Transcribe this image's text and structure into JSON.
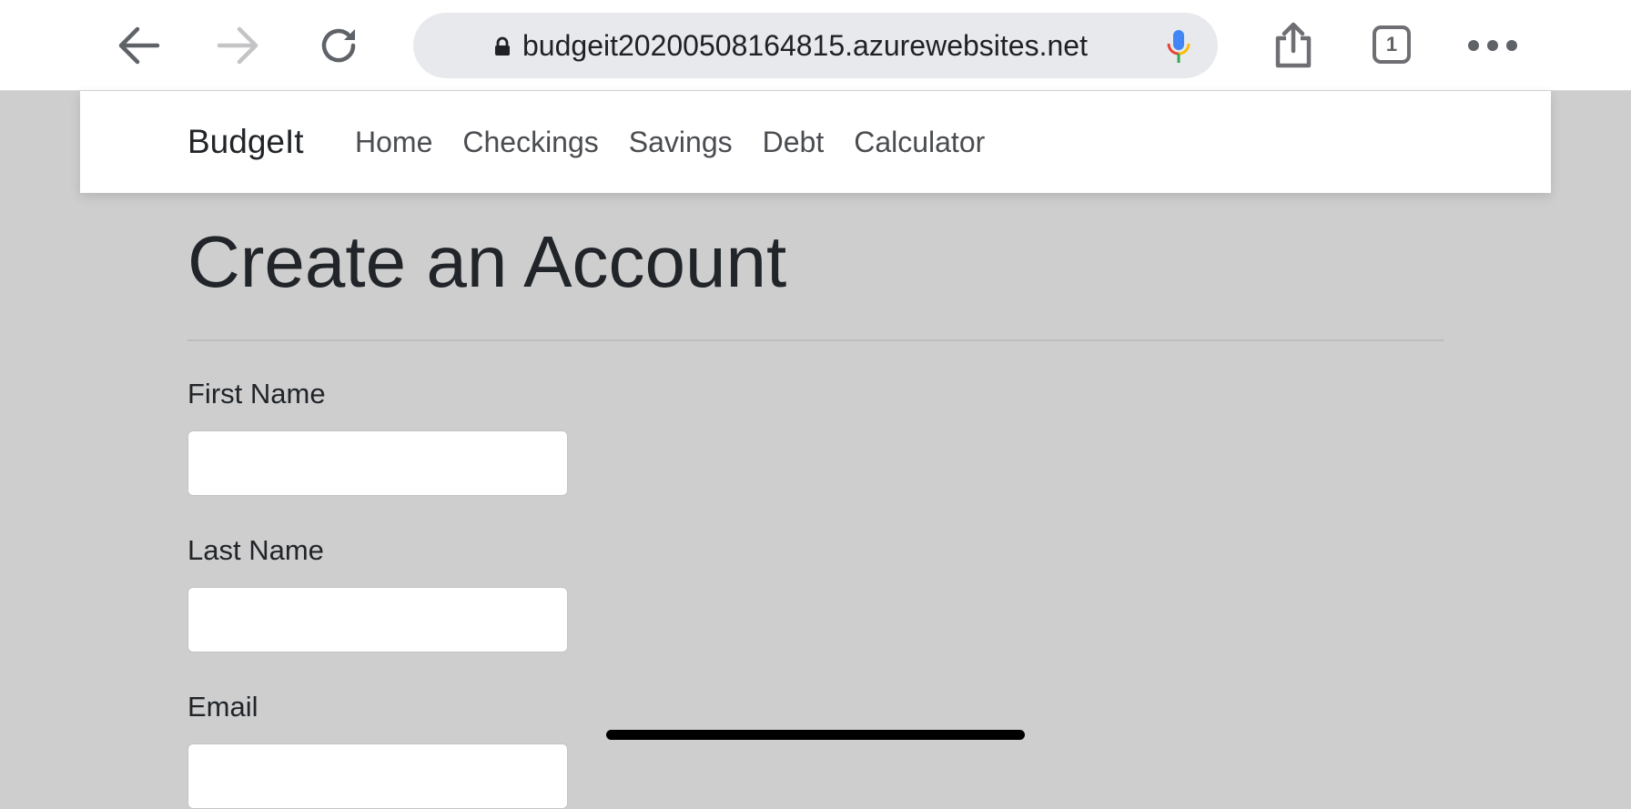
{
  "browser": {
    "url": "budgeit20200508164815.azurewebsites.net",
    "tab_count": "1"
  },
  "nav": {
    "brand": "BudgeIt",
    "links": [
      "Home",
      "Checkings",
      "Savings",
      "Debt",
      "Calculator"
    ]
  },
  "form": {
    "title": "Create an Account",
    "fields": [
      {
        "label": "First Name",
        "value": ""
      },
      {
        "label": "Last Name",
        "value": ""
      },
      {
        "label": "Email",
        "value": ""
      }
    ]
  },
  "colors": {
    "page_background": "#cecece",
    "navbar_background": "#ffffff",
    "url_pill": "#e8e9ec"
  }
}
